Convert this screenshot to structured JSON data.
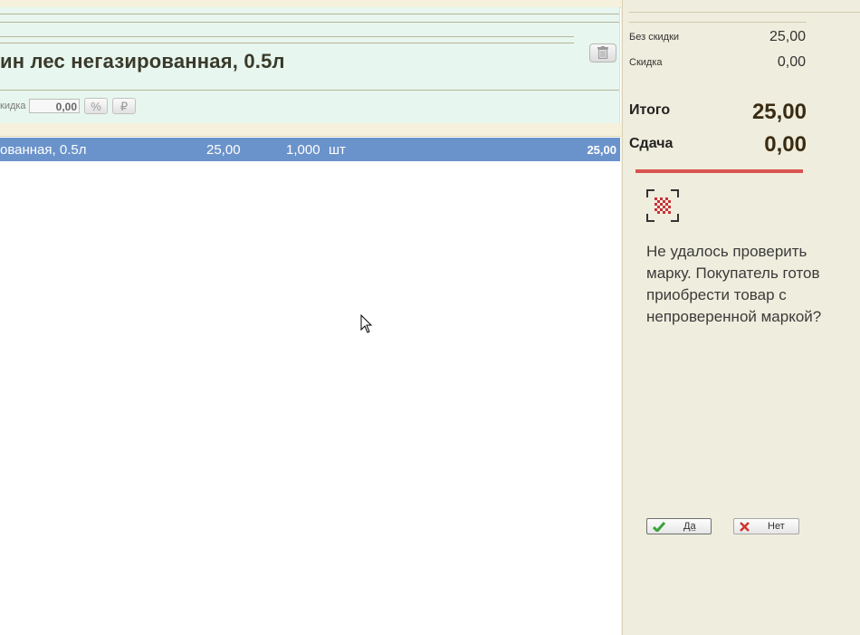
{
  "product": {
    "title": "ин лес негазированная, 0.5л",
    "discount_label": "кидка",
    "discount_value": "0,00",
    "percent_symbol": "%",
    "ruble_symbol": "₽"
  },
  "receipt": {
    "rows": [
      {
        "name": "ованная, 0.5л",
        "price": "25,00",
        "qty": "1,000",
        "unit": "шт",
        "sum": "25,00",
        "selected": true
      }
    ]
  },
  "totals": {
    "no_discount_label": "Без скидки",
    "no_discount_value": "25,00",
    "discount_label": "Скидка",
    "discount_value": "0,00",
    "total_label": "Итого",
    "total_value": "25,00",
    "change_label": "Сдача",
    "change_value": "0,00"
  },
  "dialog": {
    "message": "Не удалось проверить марку. Покупатель готов приобрести товар с непроверенной маркой?",
    "yes_label": "Да",
    "no_label": "Нет"
  },
  "colors": {
    "selected_row": "#6b93cb",
    "panel_bg": "#e7f6ee",
    "accent_red": "#d9534f",
    "yes_check": "#3aa335",
    "no_cross": "#d0342c"
  },
  "icons": [
    "trash-icon",
    "percent-icon",
    "ruble-icon",
    "mouse-cursor-icon",
    "scan-datamatrix-icon",
    "check-icon",
    "cross-icon"
  ]
}
